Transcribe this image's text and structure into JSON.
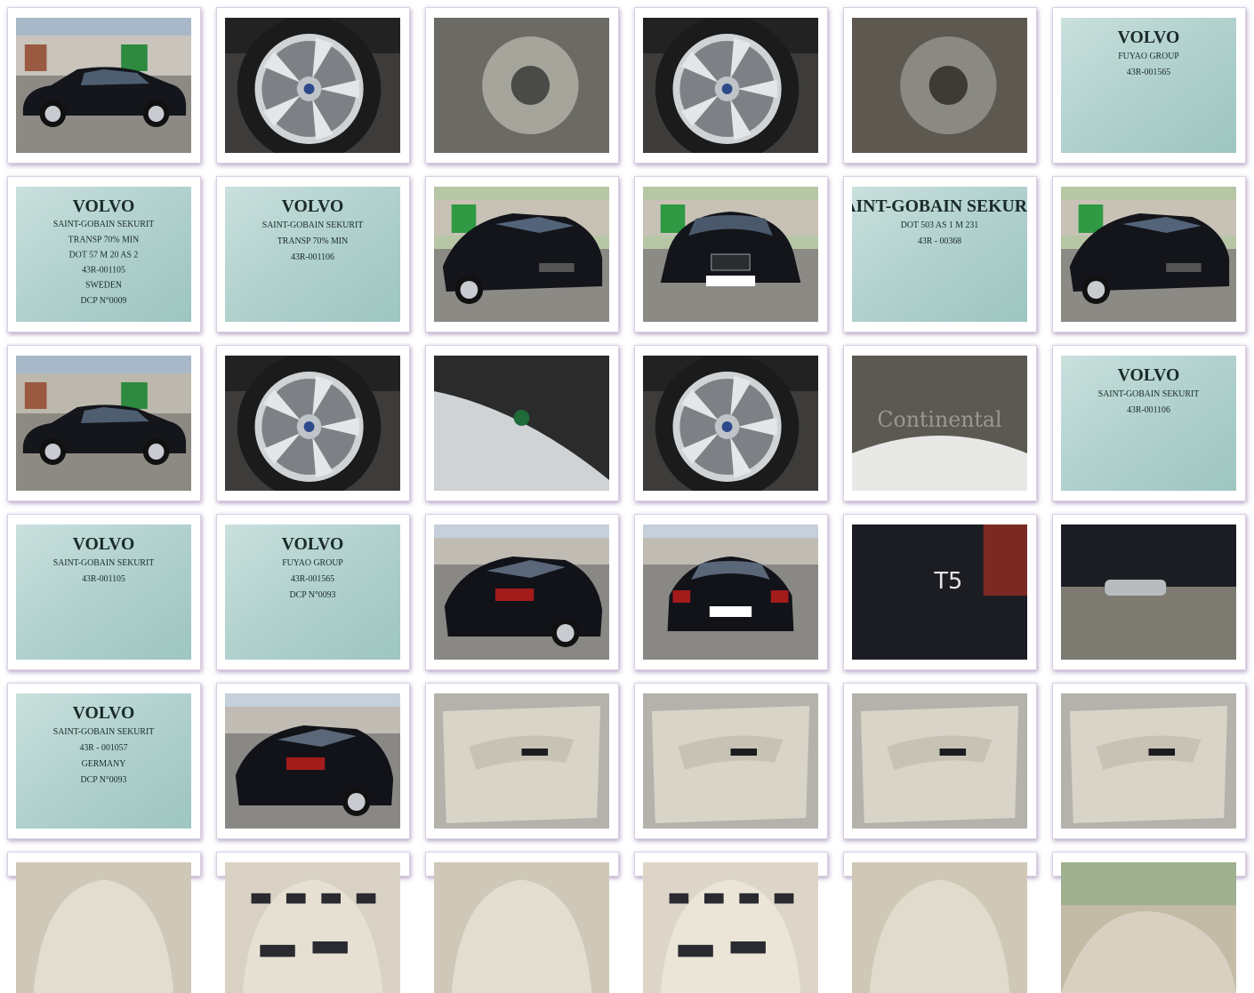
{
  "gallery": {
    "title": "",
    "columns": 6,
    "rows": 6,
    "photos": [
      {
        "kind": "car-side",
        "bg": "garage",
        "text": ""
      },
      {
        "kind": "wheel",
        "text": ""
      },
      {
        "kind": "brake",
        "text": ""
      },
      {
        "kind": "wheel",
        "text": ""
      },
      {
        "kind": "hitch",
        "text": ""
      },
      {
        "kind": "glass-mark",
        "lines": [
          "VOLVO",
          "FUYAO GROUP",
          "43R-001565"
        ]
      },
      {
        "kind": "glass-mark",
        "lines": [
          "VOLVO",
          "SAINT-GOBAIN SEKURIT",
          "TRANSP 70% MIN",
          "DOT 57 M 20 AS 2",
          "43R-001105",
          "SWEDEN",
          "DCP N°0009"
        ]
      },
      {
        "kind": "glass-mark",
        "lines": [
          "VOLVO",
          "SAINT-GOBAIN SEKURIT",
          "TRANSP 70% MIN",
          "43R-001106"
        ]
      },
      {
        "kind": "car-front34",
        "text": ""
      },
      {
        "kind": "car-front",
        "text": ""
      },
      {
        "kind": "glass-mark",
        "lines": [
          "SAINT-GOBAIN SEKURIT",
          "DOT 503 AS 1 M 231",
          "43R - 00368"
        ]
      },
      {
        "kind": "car-front34b",
        "text": ""
      },
      {
        "kind": "car-side",
        "bg": "garage2",
        "text": ""
      },
      {
        "kind": "wheel",
        "text": ""
      },
      {
        "kind": "valve",
        "text": ""
      },
      {
        "kind": "wheel",
        "text": ""
      },
      {
        "kind": "tire",
        "lines": [
          "Continental"
        ]
      },
      {
        "kind": "glass-mark",
        "lines": [
          "VOLVO",
          "SAINT-GOBAIN SEKURIT",
          "43R-001106"
        ]
      },
      {
        "kind": "glass-mark",
        "lines": [
          "VOLVO",
          "SAINT-GOBAIN SEKURIT",
          "43R-001105"
        ]
      },
      {
        "kind": "glass-mark",
        "lines": [
          "VOLVO",
          "FUYAO GROUP",
          "43R-001565",
          "DCP N°0093"
        ]
      },
      {
        "kind": "car-rear34",
        "text": ""
      },
      {
        "kind": "car-rear",
        "text": ""
      },
      {
        "kind": "badge",
        "lines": [
          "T5"
        ]
      },
      {
        "kind": "exhaust",
        "text": ""
      },
      {
        "kind": "glass-mark",
        "lines": [
          "VOLVO",
          "SAINT-GOBAIN SEKURIT",
          "43R - 001057",
          "GERMANY",
          "DCP N°0093"
        ]
      },
      {
        "kind": "car-rear34b",
        "text": ""
      },
      {
        "kind": "door",
        "text": ""
      },
      {
        "kind": "door",
        "text": ""
      },
      {
        "kind": "door",
        "text": ""
      },
      {
        "kind": "door",
        "text": ""
      },
      {
        "kind": "seat",
        "text": ""
      },
      {
        "kind": "seat-controls",
        "text": ""
      },
      {
        "kind": "seat",
        "text": ""
      },
      {
        "kind": "seat-controls2",
        "text": ""
      },
      {
        "kind": "seat-rear",
        "text": ""
      },
      {
        "kind": "rear-interior",
        "text": ""
      }
    ]
  }
}
